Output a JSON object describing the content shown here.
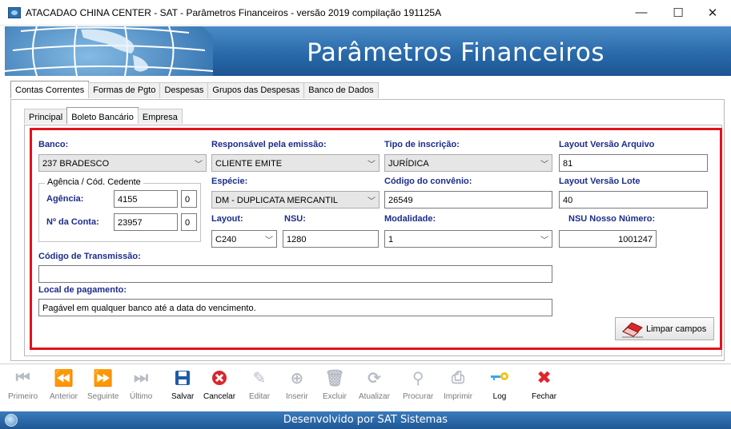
{
  "window": {
    "title": "ATACADAO CHINA CENTER - SAT - Parâmetros Financeiros - versão 2019 compilação 191125A",
    "minimize": "—",
    "maximize": "☐",
    "close": "✕"
  },
  "banner": {
    "title": "Parâmetros Financeiros"
  },
  "main_tabs": [
    "Contas Correntes",
    "Formas de Pgto",
    "Despesas",
    "Grupos das Despesas",
    "Banco de Dados"
  ],
  "sub_tabs": [
    "Principal",
    "Boleto Bancário",
    "Empresa"
  ],
  "form": {
    "banco": {
      "label": "Banco:",
      "value": "237 BRADESCO"
    },
    "responsavel": {
      "label": "Responsável pela emissão:",
      "value": "CLIENTE EMITE"
    },
    "tipo_inscricao": {
      "label": "Tipo de inscrição:",
      "value": "JURÍDICA"
    },
    "layout_versao_arquivo": {
      "label": "Layout Versão Arquivo",
      "value": "81"
    },
    "agencia_group": {
      "title": "Agência / Cód. Cedente"
    },
    "agencia": {
      "label": "Agência:",
      "value": "4155",
      "digit": "0"
    },
    "conta": {
      "label": "Nº da Conta:",
      "value": "23957",
      "digit": "0"
    },
    "especie": {
      "label": "Espécie:",
      "value": "DM - DUPLICATA MERCANTIL"
    },
    "codigo_convenio": {
      "label": "Código do convênio:",
      "value": "26549"
    },
    "layout_versao_lote": {
      "label": "Layout Versão Lote",
      "value": "40"
    },
    "layout": {
      "label": "Layout:",
      "value": "C240"
    },
    "nsu": {
      "label": "NSU:",
      "value": "1280"
    },
    "modalidade": {
      "label": "Modalidade:",
      "value": "1"
    },
    "nsu_nosso_numero": {
      "label": "NSU Nosso Número:",
      "value": "1001247"
    },
    "codigo_transmissao": {
      "label": "Código de Transmissão:",
      "value": ""
    },
    "local_pagamento": {
      "label": "Local de pagamento:",
      "value": "Pagável em qualquer banco até a data do vencimento."
    },
    "limpar": {
      "label": "Limpar campos"
    }
  },
  "toolbar": {
    "primeiro": "Primeiro",
    "anterior": "Anterior",
    "seguinte": "Seguinte",
    "ultimo": "Último",
    "salvar": "Salvar",
    "cancelar": "Cancelar",
    "editar": "Editar",
    "inserir": "Inserir",
    "excluir": "Excluir",
    "atualizar": "Atualizar",
    "procurar": "Procurar",
    "imprimir": "Imprimir",
    "log": "Log",
    "fechar": "Fechar"
  },
  "status": {
    "text": "Desenvolvido por SAT Sistemas"
  },
  "colors": {
    "label_blue": "#1c2c8c",
    "highlight_red": "#e3121b",
    "banner_blue": "#2a6aaa",
    "save_blue": "#1f5aa8",
    "cancel_red": "#d9262c",
    "close_red": "#e0252b"
  }
}
